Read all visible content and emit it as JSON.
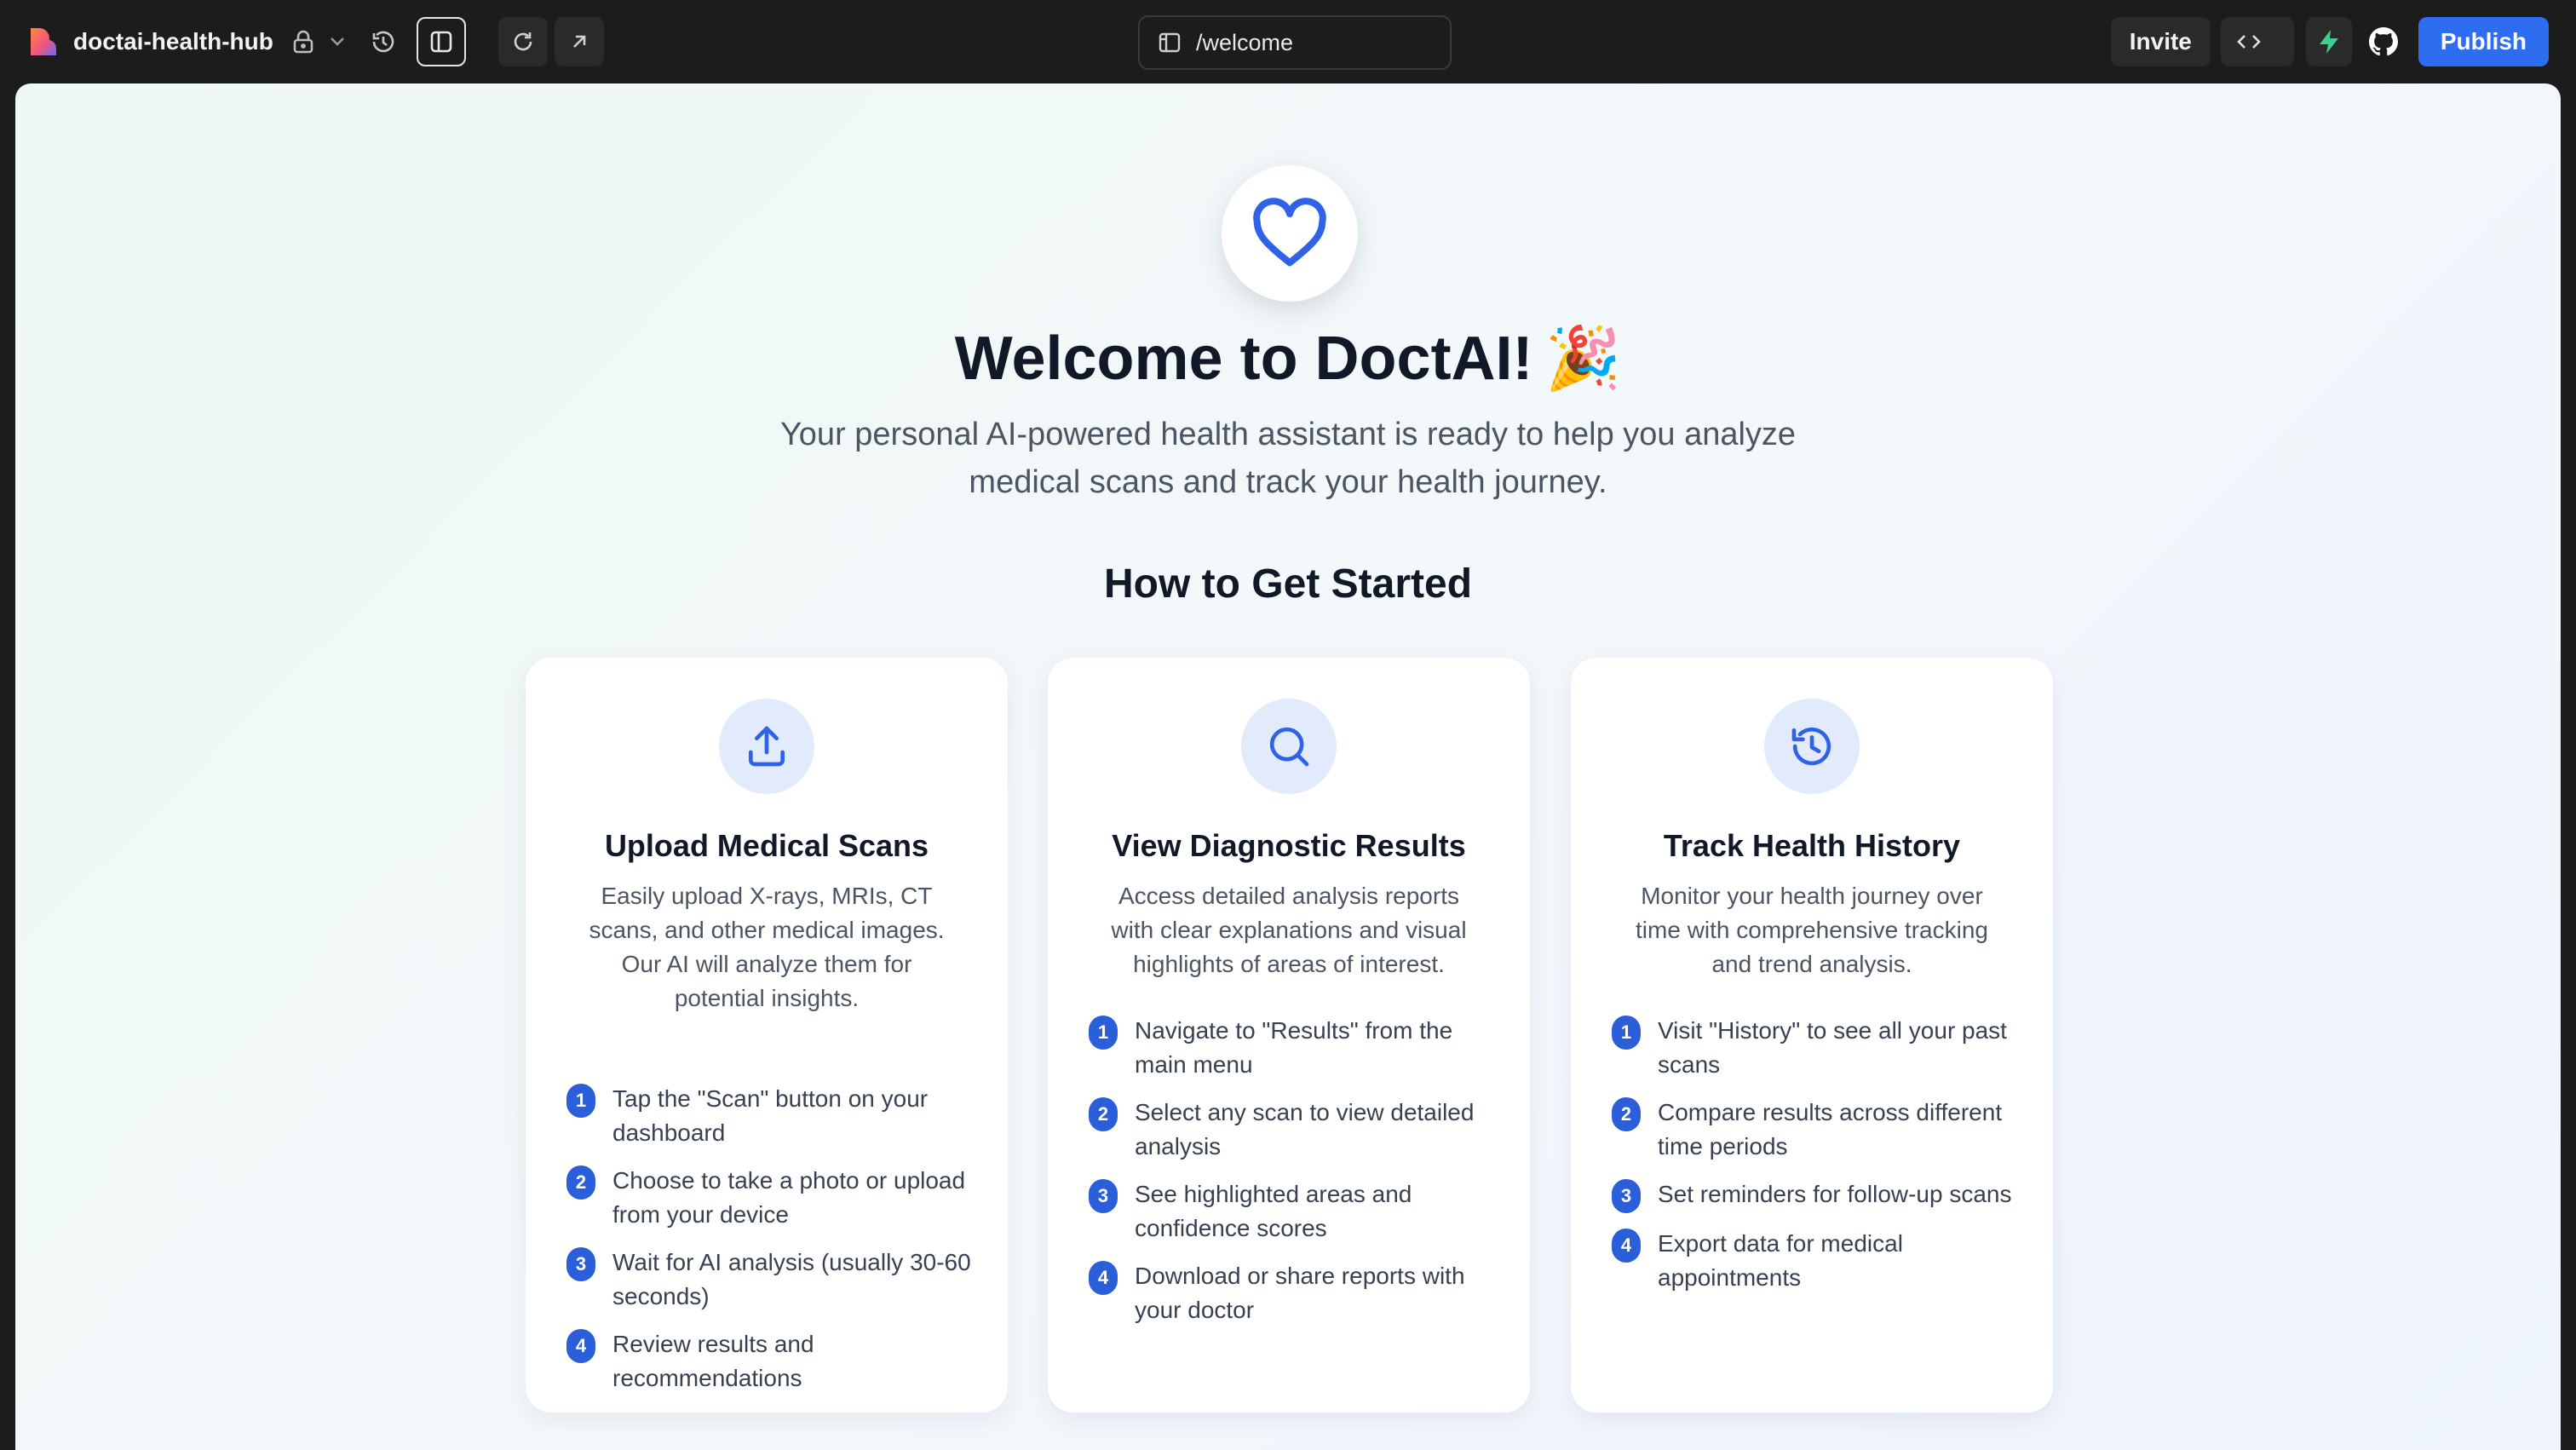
{
  "topbar": {
    "project_name": "doctai-health-hub",
    "url": "/welcome",
    "invite_label": "Invite",
    "publish_label": "Publish"
  },
  "colors": {
    "accent": "#2e6cf0",
    "step_badge": "#2b5fd9",
    "heart": "#2f62e6",
    "icon_circle": "#e2ebfb"
  },
  "welcome": {
    "title": "Welcome to DoctAI!",
    "emoji": "🎉",
    "subtitle_line1": "Your personal AI-powered health assistant is ready to help you analyze",
    "subtitle_line2": "medical scans and track your health journey.",
    "section_title": "How to Get Started"
  },
  "cards": [
    {
      "icon": "upload-icon",
      "title": "Upload Medical Scans",
      "description": "Easily upload X-rays, MRIs, CT scans, and other medical images. Our AI will analyze them for potential insights.",
      "steps": [
        {
          "num": "1",
          "text": "Tap the \"Scan\" button on your dashboard"
        },
        {
          "num": "2",
          "text": "Choose to take a photo or upload from your device"
        },
        {
          "num": "3",
          "text": "Wait for AI analysis (usually 30-60 seconds)"
        },
        {
          "num": "4",
          "text": "Review results and recommendations"
        }
      ]
    },
    {
      "icon": "search-icon",
      "title": "View Diagnostic Results",
      "description": "Access detailed analysis reports with clear explanations and visual highlights of areas of interest.",
      "steps": [
        {
          "num": "1",
          "text": "Navigate to \"Results\" from the main menu"
        },
        {
          "num": "2",
          "text": "Select any scan to view detailed analysis"
        },
        {
          "num": "3",
          "text": "See highlighted areas and confidence scores"
        },
        {
          "num": "4",
          "text": "Download or share reports with your doctor"
        }
      ]
    },
    {
      "icon": "history-icon",
      "title": "Track Health History",
      "description": "Monitor your health journey over time with comprehensive tracking and trend analysis.",
      "steps": [
        {
          "num": "1",
          "text": "Visit \"History\" to see all your past scans"
        },
        {
          "num": "2",
          "text": "Compare results across different time periods"
        },
        {
          "num": "3",
          "text": "Set reminders for follow-up scans"
        },
        {
          "num": "4",
          "text": "Export data for medical appointments"
        }
      ]
    }
  ]
}
